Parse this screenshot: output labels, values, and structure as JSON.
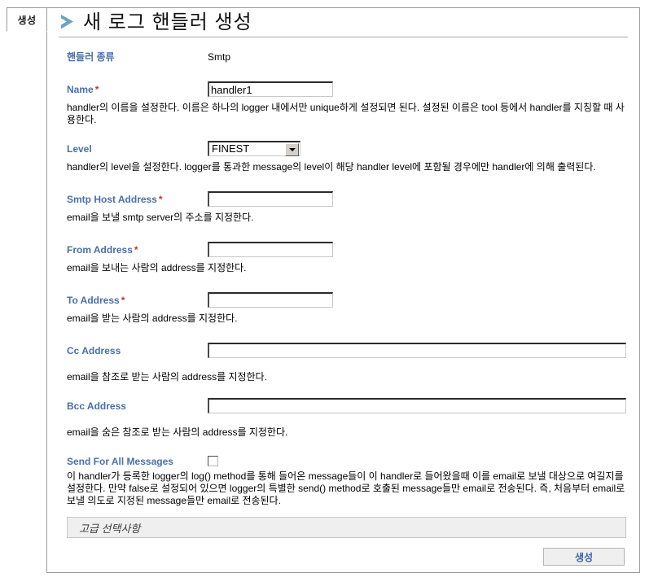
{
  "tab": {
    "label": "생성"
  },
  "header": {
    "title": "새 로그 핸들러 생성",
    "chevron_icon": "chevron-right-icon",
    "chevron_color": "#6ba3c4"
  },
  "colors": {
    "label_blue": "#4a6fa8",
    "required_red": "#c0392b",
    "button_text": "#3b62a8",
    "panel_border": "#9a9a9a"
  },
  "form": {
    "handler_type": {
      "label": "핸들러 종류",
      "value": "Smtp"
    },
    "name": {
      "label": "Name",
      "required": "*",
      "value": "handler1",
      "description": "handler의 이름을 설정한다. 이름은 하나의 logger 내에서만 unique하게 설정되면 된다. 설정된 이름은 tool 등에서 handler를 지칭할 때 사용한다."
    },
    "level": {
      "label": "Level",
      "value": "FINEST",
      "options": [
        "FINEST"
      ],
      "description": "handler의 level을 설정한다. logger를 통과한 message의 level이 해당 handler level에 포함될 경우에만 handler에 의해 출력된다."
    },
    "smtp_host": {
      "label": "Smtp Host Address",
      "required": "*",
      "value": "",
      "description": "email을 보낼 smtp server의 주소를 지정한다."
    },
    "from_address": {
      "label": "From Address",
      "required": "*",
      "value": "",
      "description": "email을 보내는 사람의 address를 지정한다."
    },
    "to_address": {
      "label": "To Address",
      "required": "*",
      "value": "",
      "description": "email을 받는 사람의 address를 지정한다."
    },
    "cc_address": {
      "label": "Cc Address",
      "value": "",
      "description": "email을 참조로 받는 사람의 address를 지정한다."
    },
    "bcc_address": {
      "label": "Bcc Address",
      "value": "",
      "description": "email을 숨은 참조로 받는 사람의 address를 지정한다."
    },
    "send_all": {
      "label": "Send For All Messages",
      "checked": false,
      "description": "이 handler가 등록한 logger의 log() method를 통해 들어온 message들이 이 handler로 들어왔을때 이를 email로 보낼 대상으로 여길지를 설정한다. 만약 false로 설정되어 있으면 logger의 특별한 send() method로 호출된 message들만 email로 전송된다. 즉, 처음부터 email로 보낼 의도로 지정된 message들만 email로 전송된다."
    }
  },
  "advanced": {
    "label": "고급 선택사항"
  },
  "footer": {
    "submit_label": "생성"
  }
}
